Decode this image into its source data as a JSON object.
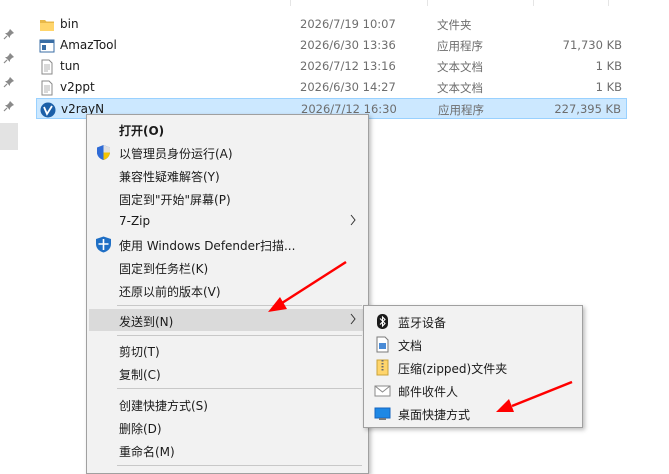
{
  "files": [
    {
      "name": "bin",
      "date": "2026/7/19 10:07",
      "type": "文件夹",
      "size": "",
      "icon": "folder-icon"
    },
    {
      "name": "AmazTool",
      "date": "2026/6/30 13:36",
      "type": "应用程序",
      "size": "71,730 KB",
      "icon": "app-window-icon"
    },
    {
      "name": "tun",
      "date": "2026/7/12 13:16",
      "type": "文本文档",
      "size": "1 KB",
      "icon": "text-file-icon"
    },
    {
      "name": "v2ppt",
      "date": "2026/6/30 14:27",
      "type": "文本文档",
      "size": "1 KB",
      "icon": "text-file-icon"
    },
    {
      "name": "v2rayN",
      "date": "2026/7/12 16:30",
      "type": "应用程序",
      "size": "227,395 KB",
      "icon": "v2rayn-icon"
    }
  ],
  "context_menu": {
    "items": [
      {
        "label": "打开(O)"
      },
      {
        "label": "以管理员身份运行(A)",
        "icon": "uac-shield-icon"
      },
      {
        "label": "兼容性疑难解答(Y)"
      },
      {
        "label": "固定到\"开始\"屏幕(P)"
      },
      {
        "label": "7-Zip"
      },
      {
        "label": "使用 Windows Defender扫描...",
        "icon": "defender-shield-icon"
      },
      {
        "label": "固定到任务栏(K)"
      },
      {
        "label": "还原以前的版本(V)"
      },
      {
        "label": "发送到(N)"
      },
      {
        "label": "剪切(T)"
      },
      {
        "label": "复制(C)"
      },
      {
        "label": "创建快捷方式(S)"
      },
      {
        "label": "删除(D)"
      },
      {
        "label": "重命名(M)"
      }
    ]
  },
  "send_to_menu": {
    "items": [
      {
        "label": "蓝牙设备",
        "icon": "bluetooth-icon"
      },
      {
        "label": "文档",
        "icon": "documents-icon"
      },
      {
        "label": "压缩(zipped)文件夹",
        "icon": "zip-folder-icon"
      },
      {
        "label": "邮件收件人",
        "icon": "mail-recipient-icon"
      },
      {
        "label": "桌面快捷方式",
        "icon": "desktop-icon"
      }
    ]
  },
  "colors": {
    "selection": "#cce8ff",
    "selection_border": "#99d1ff",
    "menu_bg": "#f2f2f2",
    "menu_hover": "#dadada",
    "annotation_arrow": "#ff0000"
  }
}
